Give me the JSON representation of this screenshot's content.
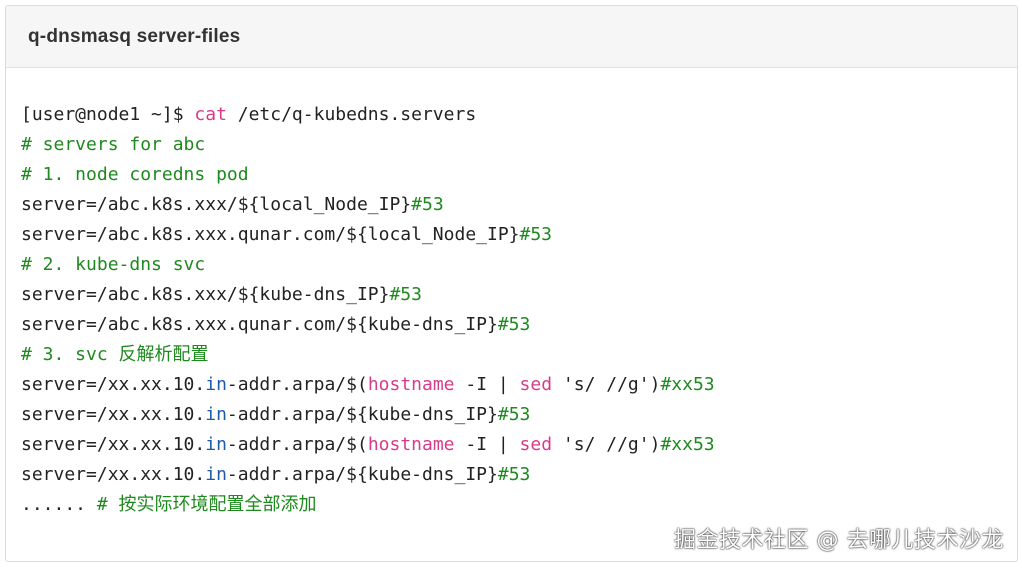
{
  "card": {
    "title": "q-dnsmasq server-files"
  },
  "colors": {
    "comment": "#1e8a1e",
    "keyword": "#d63b8a",
    "builtin": "#1f5aa8",
    "text": "#222222",
    "header_bg": "#f6f6f6"
  },
  "code_lines": [
    [
      {
        "t": "[user@node1 ~]$ ",
        "c": "default"
      },
      {
        "t": "cat",
        "c": "keyword"
      },
      {
        "t": " /etc/q-kubedns.servers",
        "c": "default"
      }
    ],
    [
      {
        "t": "# servers for abc",
        "c": "comment"
      }
    ],
    [
      {
        "t": "# 1. node coredns pod",
        "c": "comment"
      }
    ],
    [
      {
        "t": "server=/abc.k8s.xxx/${local_Node_IP}",
        "c": "default"
      },
      {
        "t": "#53",
        "c": "comment"
      }
    ],
    [
      {
        "t": "server=/abc.k8s.xxx.qunar.com/${local_Node_IP}",
        "c": "default"
      },
      {
        "t": "#53",
        "c": "comment"
      }
    ],
    [
      {
        "t": "# 2. kube-dns svc",
        "c": "comment"
      }
    ],
    [
      {
        "t": "server=/abc.k8s.xxx/${kube-dns_IP}",
        "c": "default"
      },
      {
        "t": "#53",
        "c": "comment"
      }
    ],
    [
      {
        "t": "server=/abc.k8s.xxx.qunar.com/${kube-dns_IP}",
        "c": "default"
      },
      {
        "t": "#53",
        "c": "comment"
      }
    ],
    [
      {
        "t": "# 3. svc 反解析配置",
        "c": "comment"
      }
    ],
    [
      {
        "t": "server=/xx.xx.10.",
        "c": "default"
      },
      {
        "t": "in",
        "c": "builtin"
      },
      {
        "t": "-addr.arpa/$(",
        "c": "default"
      },
      {
        "t": "hostname",
        "c": "keyword"
      },
      {
        "t": " -I | ",
        "c": "default"
      },
      {
        "t": "sed",
        "c": "keyword"
      },
      {
        "t": " 's/ //g')",
        "c": "default"
      },
      {
        "t": "#xx53",
        "c": "comment"
      }
    ],
    [
      {
        "t": "server=/xx.xx.10.",
        "c": "default"
      },
      {
        "t": "in",
        "c": "builtin"
      },
      {
        "t": "-addr.arpa/${kube-dns_IP}",
        "c": "default"
      },
      {
        "t": "#53",
        "c": "comment"
      }
    ],
    [
      {
        "t": "server=/xx.xx.10.",
        "c": "default"
      },
      {
        "t": "in",
        "c": "builtin"
      },
      {
        "t": "-addr.arpa/$(",
        "c": "default"
      },
      {
        "t": "hostname",
        "c": "keyword"
      },
      {
        "t": " -I | ",
        "c": "default"
      },
      {
        "t": "sed",
        "c": "keyword"
      },
      {
        "t": " 's/ //g')",
        "c": "default"
      },
      {
        "t": "#xx53",
        "c": "comment"
      }
    ],
    [
      {
        "t": "server=/xx.xx.10.",
        "c": "default"
      },
      {
        "t": "in",
        "c": "builtin"
      },
      {
        "t": "-addr.arpa/${kube-dns_IP}",
        "c": "default"
      },
      {
        "t": "#53",
        "c": "comment"
      }
    ],
    [
      {
        "t": "...... ",
        "c": "default"
      },
      {
        "t": "# 按实际环境配置全部添加",
        "c": "comment"
      }
    ]
  ],
  "watermark": {
    "text": "掘金技术社区 @ 去哪儿技术沙龙"
  }
}
